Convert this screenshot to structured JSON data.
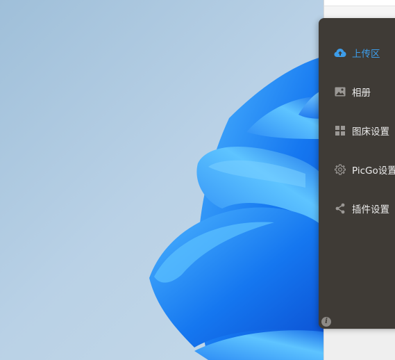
{
  "sidebar": {
    "items": [
      {
        "label": "上传区",
        "icon": "cloud-upload-icon",
        "active": true
      },
      {
        "label": "相册",
        "icon": "image-icon",
        "active": false
      },
      {
        "label": "图床设置",
        "icon": "grid-icon",
        "active": false
      },
      {
        "label": "PicGo设置",
        "icon": "gear-icon",
        "active": false
      },
      {
        "label": "插件设置",
        "icon": "share-icon",
        "active": false
      }
    ],
    "info_icon": "info-icon",
    "colors": {
      "background": "#3f3b36",
      "active": "#3d9dea",
      "text": "#ececec",
      "icon": "#9b9895"
    }
  }
}
